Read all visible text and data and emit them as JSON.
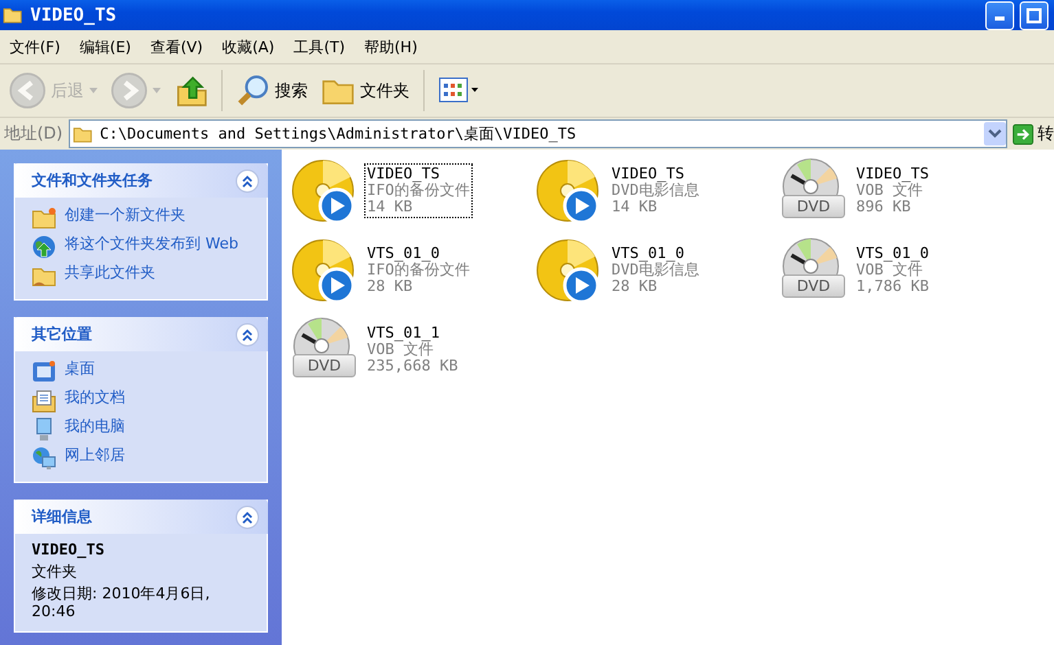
{
  "window": {
    "title": "VIDEO_TS"
  },
  "menu": [
    {
      "label": "文件(F)"
    },
    {
      "label": "编辑(E)"
    },
    {
      "label": "查看(V)"
    },
    {
      "label": "收藏(A)"
    },
    {
      "label": "工具(T)"
    },
    {
      "label": "帮助(H)"
    }
  ],
  "toolbar": [
    {
      "kind": "back",
      "label": "后退",
      "disabled": true
    },
    {
      "kind": "forward",
      "disabled": true
    },
    {
      "kind": "up",
      "disabled": false
    },
    {
      "kind": "search",
      "label": "搜索",
      "disabled": false
    },
    {
      "kind": "folders",
      "label": "文件夹",
      "disabled": false
    },
    {
      "kind": "views",
      "disabled": false
    }
  ],
  "address": {
    "label": "地址(D)",
    "value": "C:\\Documents and Settings\\Administrator\\桌面\\VIDEO_TS",
    "go": "转"
  },
  "sidebar": [
    {
      "title": "文件和文件夹任务",
      "expanded": true,
      "items": [
        {
          "kind": "new-folder",
          "label": "创建一个新文件夹"
        },
        {
          "kind": "publish",
          "label": "将这个文件夹发布到 Web"
        },
        {
          "kind": "share",
          "label": "共享此文件夹"
        }
      ]
    },
    {
      "title": "其它位置",
      "expanded": true,
      "items": [
        {
          "kind": "desktop",
          "label": "桌面"
        },
        {
          "kind": "documents",
          "label": "我的文档"
        },
        {
          "kind": "computer",
          "label": "我的电脑"
        },
        {
          "kind": "network",
          "label": "网上邻居"
        }
      ]
    },
    {
      "title": "详细信息",
      "expanded": true,
      "details": {
        "name": "VIDEO_TS",
        "type": "文件夹",
        "modified": "修改日期: 2010年4月6日, 20:46"
      }
    }
  ],
  "files": [
    {
      "kind": "ifo",
      "name": "VIDEO_TS",
      "type": "IFO的备份文件",
      "size": "14 KB",
      "focused": true
    },
    {
      "kind": "ifo",
      "name": "VIDEO_TS",
      "type": "DVD电影信息",
      "size": "14 KB",
      "focused": false
    },
    {
      "kind": "vob",
      "badge": "DVD",
      "name": "VIDEO_TS",
      "type": "VOB 文件",
      "size": "896 KB",
      "focused": false
    },
    {
      "kind": "ifo",
      "name": "VTS_01_0",
      "type": "IFO的备份文件",
      "size": "28 KB",
      "focused": false
    },
    {
      "kind": "ifo",
      "name": "VTS_01_0",
      "type": "DVD电影信息",
      "size": "28 KB",
      "focused": false
    },
    {
      "kind": "vob",
      "badge": "DVD",
      "name": "VTS_01_0",
      "type": "VOB 文件",
      "size": "1,786 KB",
      "focused": false
    },
    {
      "kind": "vob",
      "badge": "DVD",
      "name": "VTS_01_1",
      "type": "VOB 文件",
      "size": "235,668 KB",
      "focused": false
    }
  ]
}
